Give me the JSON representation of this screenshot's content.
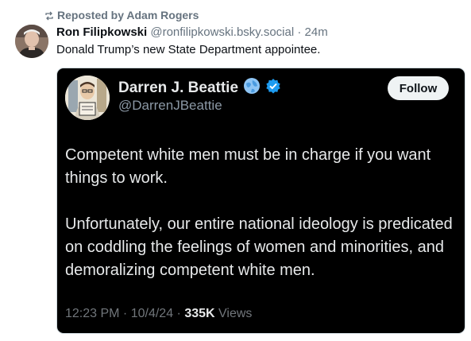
{
  "repost": {
    "label": "Reposted by Adam Rogers",
    "icon": "repost-icon"
  },
  "post": {
    "author_name": "Ron Filipkowski",
    "author_handle": "@ronfilipkowski.bsky.social",
    "separator": " · ",
    "time": "24m",
    "text": "Donald Trump’s new State Department appointee."
  },
  "embed": {
    "name": "Darren J. Beattie",
    "handle": "@DarrenJBeattie",
    "follow_label": "Follow",
    "paragraphs": [
      "Competent white men must be in charge if you want things to work.",
      "Unfortunately, our entire national ideology is predicated on coddling the feelings of women and minorities, and demoralizing competent white men."
    ],
    "time": "12:23 PM",
    "sep": " · ",
    "date": "10/4/24",
    "views_count": "335K",
    "views_label": " Views",
    "icons": [
      "globe-icon",
      "verified-badge-icon"
    ]
  },
  "colors": {
    "embed_bg": "#000000",
    "muted": "#66737f",
    "verified": "#1d9bf0",
    "follow_bg": "#eff3f4"
  }
}
